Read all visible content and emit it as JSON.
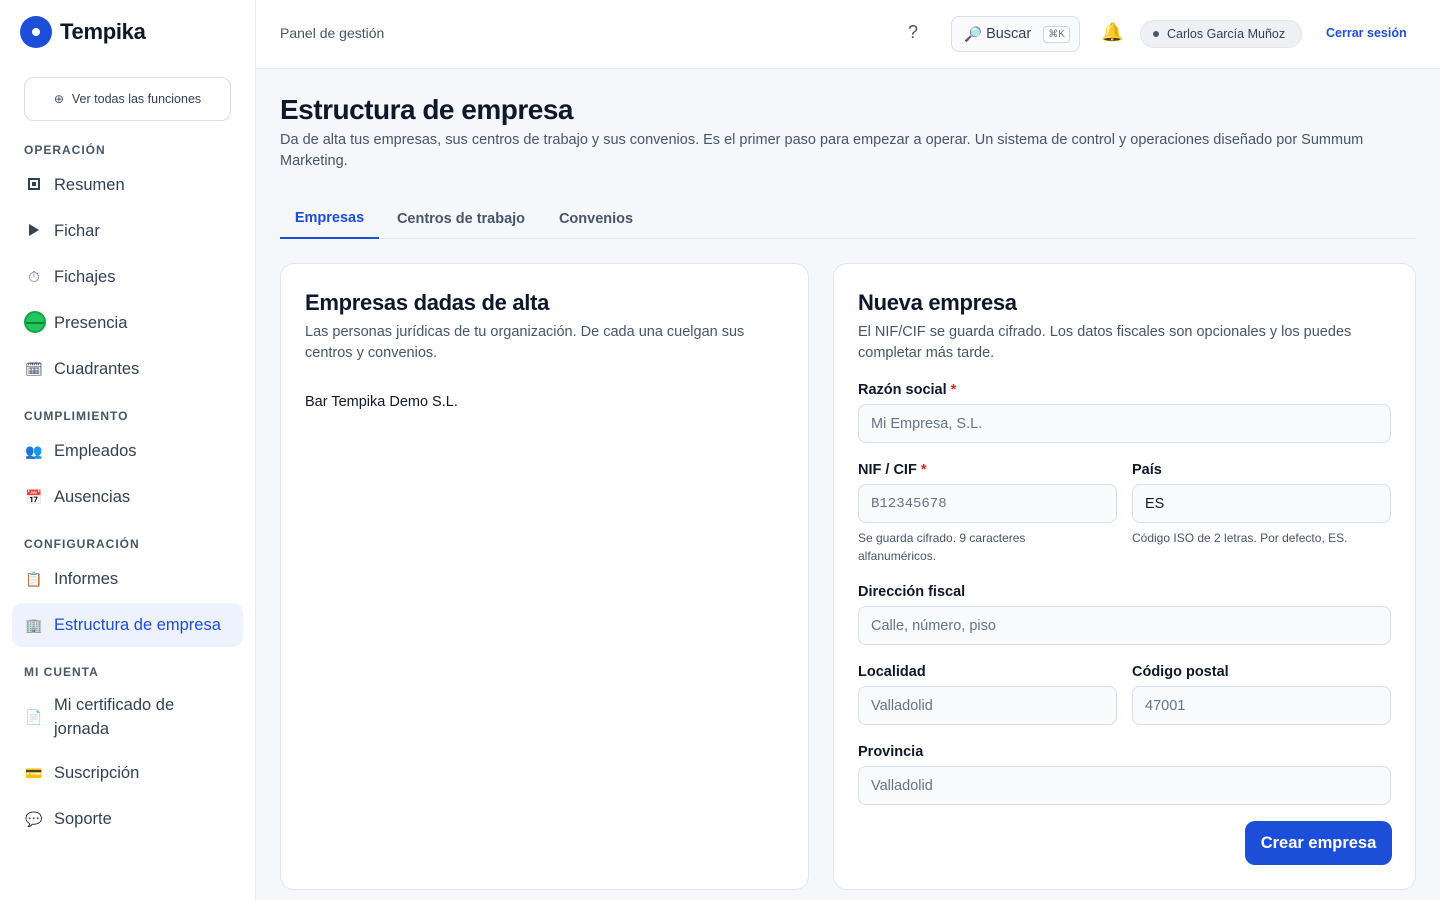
{
  "brand": {
    "name": "Tempika"
  },
  "sidebar": {
    "all_features": "Ver todas las funciones",
    "sections": {
      "operacion": "OPERACIÓN",
      "cumplimiento": "CUMPLIMIENTO",
      "configuracion": "CONFIGURACIÓN",
      "mi_cuenta": "MI CUENTA"
    },
    "items": {
      "resumen": {
        "label": "Resumen",
        "icon": "dashboard-square-icon"
      },
      "fichar": {
        "label": "Fichar",
        "icon": "play-icon"
      },
      "fichajes": {
        "label": "Fichajes",
        "icon": "stopwatch-icon"
      },
      "presencia": {
        "label": "Presencia",
        "icon": "green-circle-icon"
      },
      "cuadrantes": {
        "label": "Cuadrantes",
        "icon": "spiral-calendar-icon"
      },
      "empleados": {
        "label": "Empleados",
        "icon": "people-icon"
      },
      "ausencias": {
        "label": "Ausencias",
        "icon": "calendar-icon"
      },
      "informes": {
        "label": "Informes",
        "icon": "clipboard-icon"
      },
      "estructura": {
        "label": "Estructura de empresa",
        "icon": "office-building-icon",
        "active": true
      },
      "certificado": {
        "label": "Mi certificado de jornada",
        "icon": "document-icon"
      },
      "suscripcion": {
        "label": "Suscripción",
        "icon": "credit-card-icon"
      },
      "soporte": {
        "label": "Soporte",
        "icon": "speech-bubble-icon"
      }
    }
  },
  "header": {
    "breadcrumb": "Panel de gestión",
    "help": "?",
    "search_label": "Buscar",
    "search_shortcut": "⌘K",
    "user_name": "Carlos García Muñoz",
    "logout": "Cerrar sesión"
  },
  "main": {
    "title": "Estructura de empresa",
    "description": "Da de alta tus empresas, sus centros de trabajo y sus convenios. Es el primer paso para empezar a operar. Un sistema de control y operaciones diseñado por Summum Marketing.",
    "tabs": [
      {
        "label": "Empresas",
        "active": true
      },
      {
        "label": "Centros de trabajo"
      },
      {
        "label": "Convenios"
      }
    ]
  },
  "companies_card": {
    "title": "Empresas dadas de alta",
    "description_line1": "Las personas jurídicas de tu organización. De cada una cuelgan sus",
    "description_line2": "centros y convenios.",
    "items": [
      "Bar Tempika Demo S.L."
    ]
  },
  "form": {
    "title": "Nueva empresa",
    "description_line1": "El NIF/CIF se guarda cifrado. Los datos fiscales son opcionales y los puedes",
    "description_line2": "completar más tarde.",
    "required_mark": "*",
    "razon_social": {
      "label": "Razón social",
      "placeholder": "Mi Empresa, S.L."
    },
    "nif": {
      "label": "NIF / CIF",
      "placeholder": "B12345678",
      "hint_line1": "Se guarda cifrado. 9 caracteres",
      "hint_line2": "alfanuméricos."
    },
    "pais": {
      "label": "País",
      "value": "ES",
      "hint": "Código ISO de 2 letras. Por defecto, ES."
    },
    "direccion": {
      "label": "Dirección fiscal",
      "placeholder": "Calle, número, piso"
    },
    "localidad": {
      "label": "Localidad",
      "placeholder": "Valladolid"
    },
    "codigo_postal": {
      "label": "Código postal",
      "placeholder": "47001"
    },
    "provincia": {
      "label": "Provincia",
      "placeholder": "Valladolid"
    },
    "submit": "Crear empresa"
  },
  "colors": {
    "accent": "#1d4ed8",
    "active_bg": "#eef2ff",
    "required": "#dc2626"
  }
}
